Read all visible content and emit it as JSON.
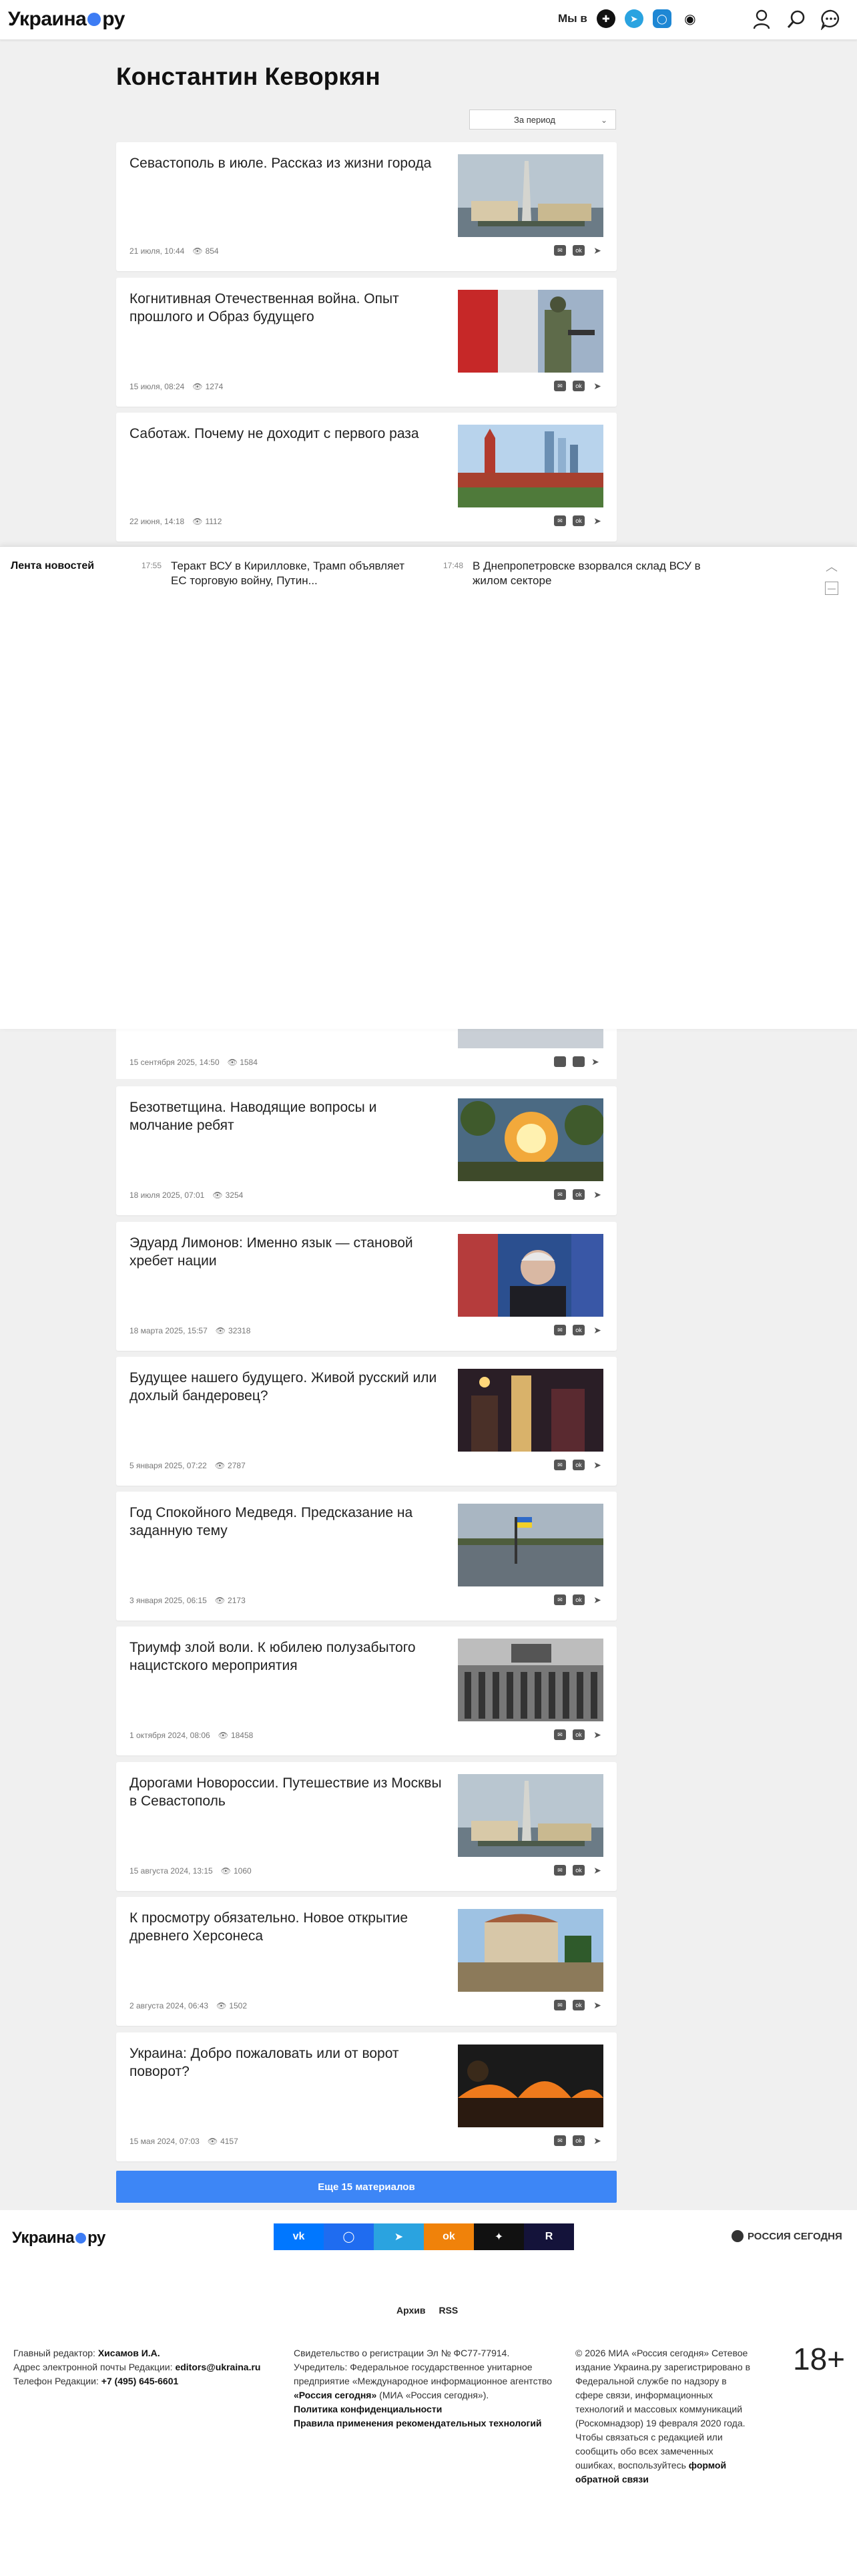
{
  "header": {
    "logo_text_1": "Украина",
    "logo_text_2": "ру",
    "social_label": "Мы в",
    "social_icons": [
      "ok-icon",
      "telegram-icon",
      "max-icon",
      "dzen-icon"
    ],
    "social_colors": [
      "#111111",
      "#2aa3e0",
      "#1e87d4",
      "#111111"
    ],
    "user_icons": [
      "user-icon",
      "search-icon",
      "chat-icon"
    ]
  },
  "page": {
    "title": "Константин Кеворкян",
    "period_select": "За период"
  },
  "articles": [
    {
      "title": "Севастополь в июле. Рассказ из жизни города",
      "date": "21 июля, 10:44",
      "views": "854",
      "image": "sevastopol-monument"
    },
    {
      "title": "Когнитивная Отечественная война. Опыт прошлого и Образ будущего",
      "date": "15 июля, 08:24",
      "views": "1274",
      "image": "soldier-flag"
    },
    {
      "title": "Саботаж. Почему не доходит с первого раза",
      "date": "22 июня, 14:18",
      "views": "1112",
      "image": "kremlin-moscow-city"
    },
    {
      "title": "Безответщина. Наводящие вопросы и молчание ребят",
      "date": "18 июля 2025, 07:01",
      "views": "3254",
      "image": "fire-explosion"
    },
    {
      "title": "Эдуард Лимонов: Именно язык — становой хребет нации",
      "date": "18 марта 2025, 15:57",
      "views": "32318",
      "image": "limonov-portrait"
    },
    {
      "title": "Будущее нашего будущего. Живой русский или дохлый бандеровец?",
      "date": "5 января 2025, 07:22",
      "views": "2787",
      "image": "night-street"
    },
    {
      "title": "Год Спокойного Медведя. Предсказание на заданную тему",
      "date": "3 января 2025, 06:15",
      "views": "2173",
      "image": "flooded-field"
    },
    {
      "title": "Триумф злой воли. К юбилею полузабытого нацистского мероприятия",
      "date": "1 октября 2024, 08:06",
      "views": "18458",
      "image": "parade-crowd"
    },
    {
      "title": "Дорогами Новороссии. Путешествие из Москвы в Севастополь",
      "date": "15 августа 2024, 13:15",
      "views": "1060",
      "image": "sevastopol-monument"
    },
    {
      "title": "К просмотру обязательно. Новое открытие древнего Херсонеса",
      "date": "2 августа 2024, 06:43",
      "views": "1502",
      "image": "chersonesus"
    },
    {
      "title": "Украина: Добро пожаловать или от ворот поворот?",
      "date": "15 мая 2024, 07:03",
      "views": "4157",
      "image": "night-fire"
    }
  ],
  "partial_article": {
    "date": "15 сентября 2025, 14:50",
    "views": "1584"
  },
  "feed": {
    "label": "Лента новостей",
    "items": [
      {
        "time": "17:55",
        "headline": "Теракт ВСУ в Кирилловке, Трамп объявляет ЕС торговую войну, Путин..."
      },
      {
        "time": "17:48",
        "headline": "В Днепропетровске взорвался склад ВСУ в жилом секторе"
      }
    ]
  },
  "more_button": "Еще 15 материалов",
  "footer": {
    "logo_text_1": "Украина",
    "logo_text_2": "ру",
    "social": [
      {
        "icon": "vk-icon",
        "color": "#0077ff",
        "glyph": "vk"
      },
      {
        "icon": "max-icon",
        "color": "#1f6cf0",
        "glyph": "◯"
      },
      {
        "icon": "telegram-icon",
        "color": "#2aa3e0",
        "glyph": "➤"
      },
      {
        "icon": "ok-icon",
        "color": "#f0820a",
        "glyph": "ok"
      },
      {
        "icon": "dzen-icon",
        "color": "#111111",
        "glyph": "✦"
      },
      {
        "icon": "rutube-icon",
        "color": "#14133a",
        "glyph": "R"
      }
    ],
    "ria_logo": "РОССИЯ СЕГОДНЯ",
    "links": [
      "Архив",
      "RSS"
    ],
    "col1": {
      "editor_label": "Главный редактор:",
      "editor_name": "Хисамов И.А.",
      "email_label": "Адрес электронной почты Редакции:",
      "email": "editors@ukraina.ru",
      "phone_label": "Телефон Редакции:",
      "phone": "+7 (495) 645-6601"
    },
    "col2": {
      "line1": "Свидетельство о регистрации Эл № ФС77-77914.",
      "line2": "Учредитель: Федеральное государственное унитарное предприятие «Международное информационное агентство",
      "agency": "«Россия сегодня»",
      "line3": "(МИА «Россия сегодня»).",
      "privacy": "Политика конфиденциальности",
      "recs": "Правила применения рекомендательных технологий"
    },
    "col3": {
      "text": "© 2026 МИА «Россия сегодня» Сетевое издание Украина.ру зарегистрировано в Федеральной службе по надзору в сфере связи, информационных технологий и массовых коммуникаций (Роскомнадзор) 19 февраля 2020 года. Чтобы связаться с редакцией или сообщить обо всех замеченных ошибках, воспользуйтесь",
      "link": "формой обратной связи"
    },
    "age": "18+"
  }
}
